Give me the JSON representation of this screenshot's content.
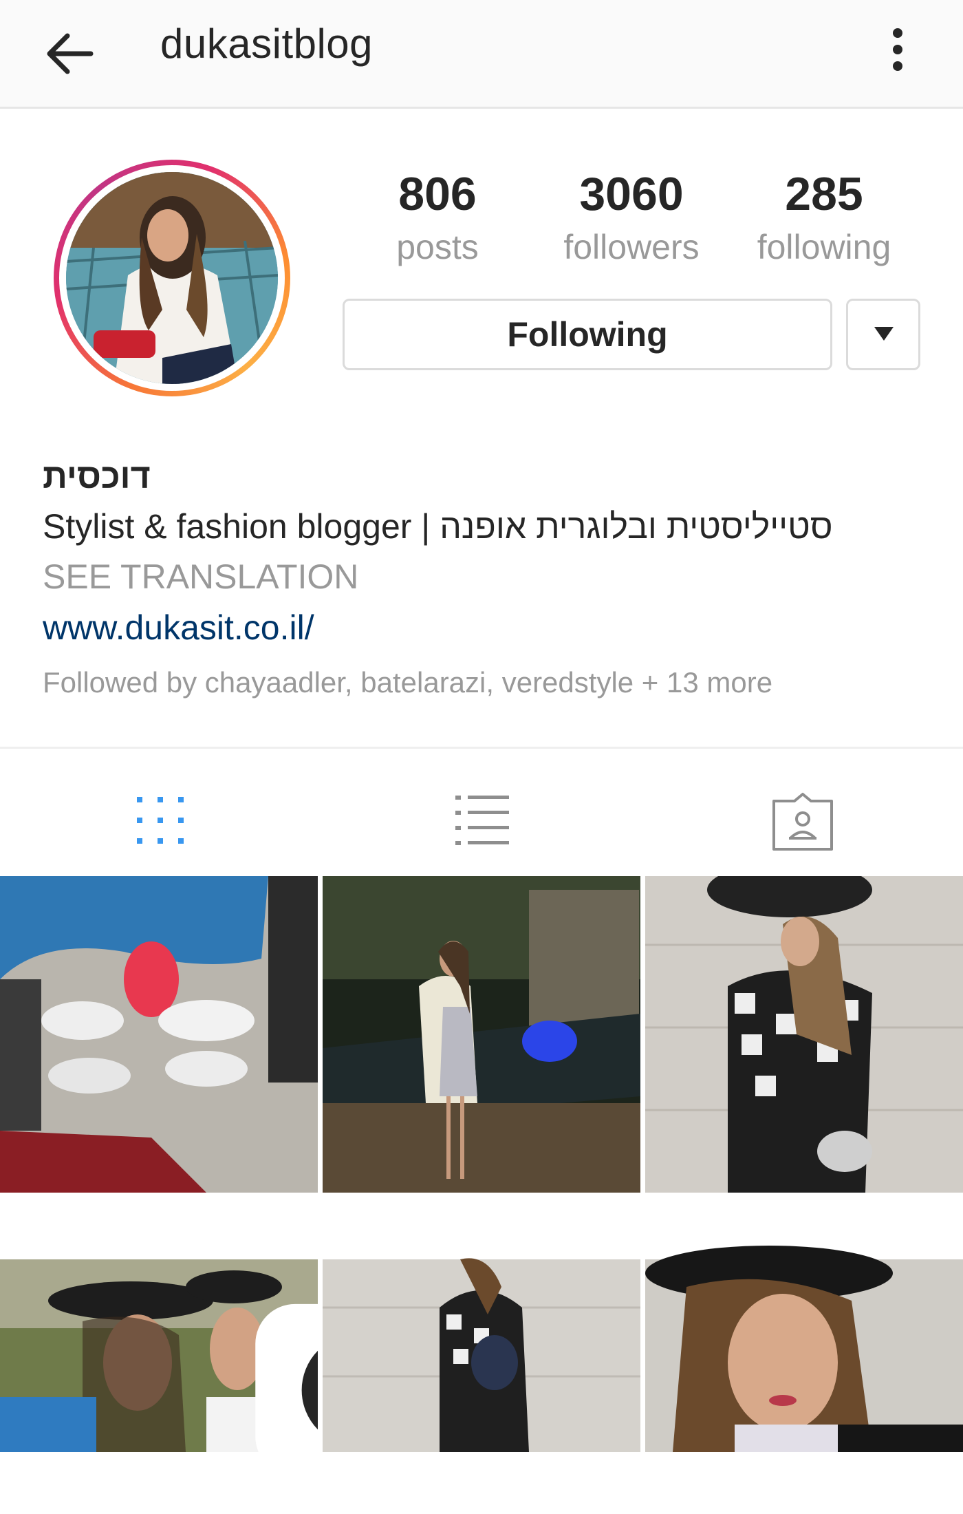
{
  "topbar": {
    "title": "dukasitblog",
    "back_icon": "arrow-left-icon",
    "more_icon": "more-vertical-icon"
  },
  "profile": {
    "avatar_icon": "profile-photo",
    "stats": {
      "posts": {
        "value": "806",
        "label": "posts"
      },
      "followers": {
        "value": "3060",
        "label": "followers"
      },
      "following": {
        "value": "285",
        "label": "following"
      }
    },
    "following_button_label": "Following",
    "dropdown_icon": "caret-down-icon",
    "full_name": "דוכסית",
    "bio": "Stylist & fashion blogger | סטייליסטית ובלוגרית אופנה",
    "see_translation": "SEE TRANSLATION",
    "website": "www.dukasit.co.il/",
    "followed_by": "Followed by chayaadler, batelarazi, veredstyle + 13 more"
  },
  "tabs": [
    {
      "name": "grid",
      "icon": "grid-icon",
      "active": true
    },
    {
      "name": "list",
      "icon": "list-icon",
      "active": false
    },
    {
      "name": "tagged",
      "icon": "tagged-photos-icon",
      "active": false
    }
  ],
  "colors": {
    "active_tab": "#3897f0",
    "inactive_tab": "#999999",
    "link": "#003569",
    "muted": "#999999",
    "text": "#262626"
  }
}
